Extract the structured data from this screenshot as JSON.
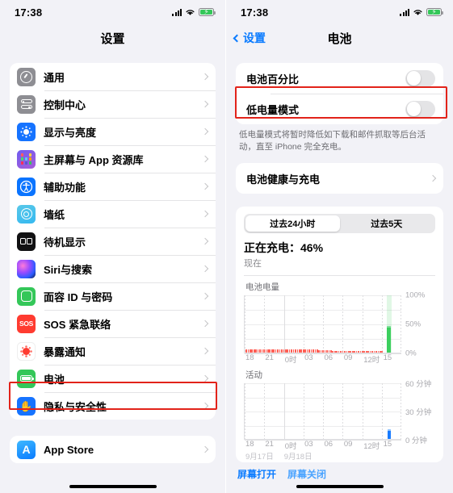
{
  "status_bar": {
    "time": "17:38",
    "signal_icon": "cellular-bars-icon",
    "wifi_icon": "wifi-icon",
    "battery_icon": "battery-charging-icon"
  },
  "left_screen": {
    "nav_title": "设置",
    "groups": [
      {
        "items": [
          {
            "label": "通用",
            "icon": "gear-icon"
          },
          {
            "label": "控制中心",
            "icon": "control-center-icon"
          },
          {
            "label": "显示与亮度",
            "icon": "brightness-icon"
          },
          {
            "label": "主屏幕与 App 资源库",
            "icon": "app-library-icon"
          },
          {
            "label": "辅助功能",
            "icon": "accessibility-icon"
          },
          {
            "label": "墙纸",
            "icon": "wallpaper-icon"
          },
          {
            "label": "待机显示",
            "icon": "standby-icon"
          },
          {
            "label": "Siri与搜索",
            "icon": "siri-icon"
          },
          {
            "label": "面容 ID 与密码",
            "icon": "face-id-icon"
          },
          {
            "label": "SOS 紧急联络",
            "icon": "sos-icon"
          },
          {
            "label": "暴露通知",
            "icon": "exposure-notification-icon"
          },
          {
            "label": "电池",
            "icon": "battery-icon"
          },
          {
            "label": "隐私与安全性",
            "icon": "privacy-hand-icon"
          }
        ]
      },
      {
        "items": [
          {
            "label": "App Store",
            "icon": "app-store-icon"
          }
        ]
      }
    ],
    "highlighted_item": "电池"
  },
  "right_screen": {
    "nav_back_label": "设置",
    "nav_title": "电池",
    "rows": [
      {
        "label": "电池百分比",
        "control": "toggle",
        "value": "off"
      },
      {
        "label": "低电量模式",
        "control": "toggle",
        "value": "off"
      }
    ],
    "footnote": "低电量模式将暂时降低如下载和邮件抓取等后台活动，直至 iPhone 完全充电。",
    "battery_health_label": "电池健康与充电",
    "highlighted_item": "低电量模式",
    "segmented": {
      "options": [
        "过去24小时",
        "过去5天"
      ],
      "selected": "过去24小时"
    },
    "charging_status": "正在充电：46%",
    "charging_time": "现在",
    "legend": {
      "screen_on": "屏幕打开",
      "screen_off": "屏幕关闭"
    }
  },
  "chart_data": [
    {
      "type": "bar",
      "title": "电池电量",
      "ylabel": "",
      "xlabel": "",
      "ylim": [
        0,
        100
      ],
      "ytick_labels": [
        "100%",
        "50%",
        "0%"
      ],
      "ytick_values": [
        100,
        50,
        0
      ],
      "xtick_labels": [
        "18",
        "21",
        "0时",
        "03",
        "06",
        "09",
        "12时",
        "15"
      ],
      "date_labels": [
        "9月17日",
        "9月18日"
      ],
      "grid": true,
      "series": [
        {
          "name": "电池电量",
          "color": "#ff5c52",
          "values": [
            3,
            3,
            3,
            3,
            3,
            3,
            3,
            3,
            3,
            3,
            3,
            3,
            3,
            3,
            3,
            3,
            3,
            3,
            3,
            3,
            3,
            3,
            3,
            3,
            3,
            3,
            3,
            3,
            3,
            3,
            3,
            3,
            3,
            3,
            3,
            3,
            3,
            2,
            2,
            2,
            2,
            2,
            2,
            2,
            1,
            1,
            1,
            1,
            1,
            1,
            1,
            1,
            0,
            0,
            0,
            0,
            0,
            0,
            0,
            0,
            0,
            0,
            0,
            0,
            0,
            0,
            0,
            0,
            0,
            0
          ]
        },
        {
          "name": "正在充电",
          "color": "#3ccf5e",
          "values": [
            46
          ]
        }
      ],
      "charging_band": true
    },
    {
      "type": "bar",
      "title": "活动",
      "ylabel": "",
      "xlabel": "",
      "ylim": [
        0,
        60
      ],
      "ytick_labels": [
        "60 分钟",
        "30 分钟",
        "0 分钟"
      ],
      "ytick_values": [
        60,
        30,
        0
      ],
      "xtick_labels": [
        "18",
        "21",
        "0时",
        "03",
        "06",
        "09",
        "12时",
        "15"
      ],
      "date_labels": [
        "9月17日",
        "9月18日"
      ],
      "grid": true,
      "series": [
        {
          "name": "屏幕打开",
          "color": "#1a7cff",
          "values": [
            11
          ]
        }
      ]
    }
  ]
}
